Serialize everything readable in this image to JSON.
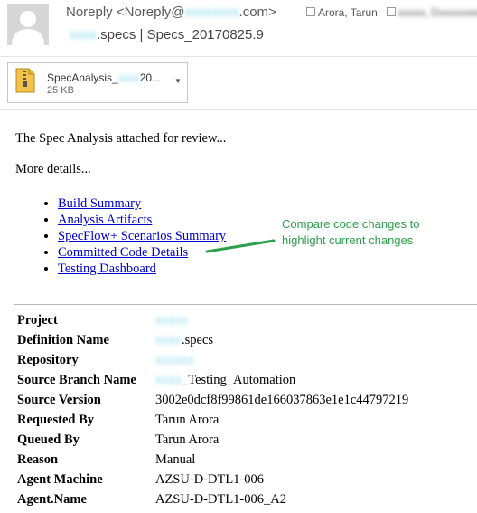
{
  "header": {
    "from_name": "Noreply",
    "from_email_prefix": "<Noreply@",
    "from_email_domain": "xxxxxxxx",
    "from_email_suffix": ".com>",
    "to_first": "Arora, Tarun;",
    "to_second": "xxxxx, Dxxxxxxer;",
    "subject_prefix": "xxxx",
    "subject_rest": ".specs | Specs_20170825.9"
  },
  "attachment": {
    "name_visible": "SpecAnalysis_",
    "name_blurred": "xxxx",
    "name_tail": "20...",
    "size": "25 KB"
  },
  "body": {
    "intro": "The Spec Analysis attached for review...",
    "more": "More details...",
    "links": [
      "Build Summary",
      "Analysis Artifacts",
      "SpecFlow+ Scenarios Summary",
      "Committed Code Details",
      "Testing Dashboard"
    ],
    "annotation_line1": "Compare code changes to",
    "annotation_line2": "highlight current changes"
  },
  "details": {
    "rows": [
      {
        "label": "Project",
        "value_blurred": "xxxxx",
        "value": ""
      },
      {
        "label": "Definition Name",
        "value_blurred": "xxxx",
        "value": ".specs"
      },
      {
        "label": "Repository",
        "value_blurred": "xxxxxx",
        "value": ""
      },
      {
        "label": "Source Branch Name",
        "value_blurred": "xxxx",
        "value": "_Testing_Automation"
      },
      {
        "label": "Source Version",
        "value_blurred": "",
        "value": "3002e0dcf8f99861de166037863e1e1c44797219"
      },
      {
        "label": "Requested By",
        "value_blurred": "",
        "value": "Tarun Arora"
      },
      {
        "label": "Queued By",
        "value_blurred": "",
        "value": "Tarun Arora"
      },
      {
        "label": "Reason",
        "value_blurred": "",
        "value": "Manual"
      },
      {
        "label": "Agent Machine",
        "value_blurred": "",
        "value": "AZSU-D-DTL1-006"
      },
      {
        "label": "Agent.Name",
        "value_blurred": "",
        "value": "AZSU-D-DTL1-006_A2"
      }
    ]
  },
  "colors": {
    "link": "#0000cc",
    "annotation": "#2aa04a",
    "redaction": "#7fd6e8"
  }
}
